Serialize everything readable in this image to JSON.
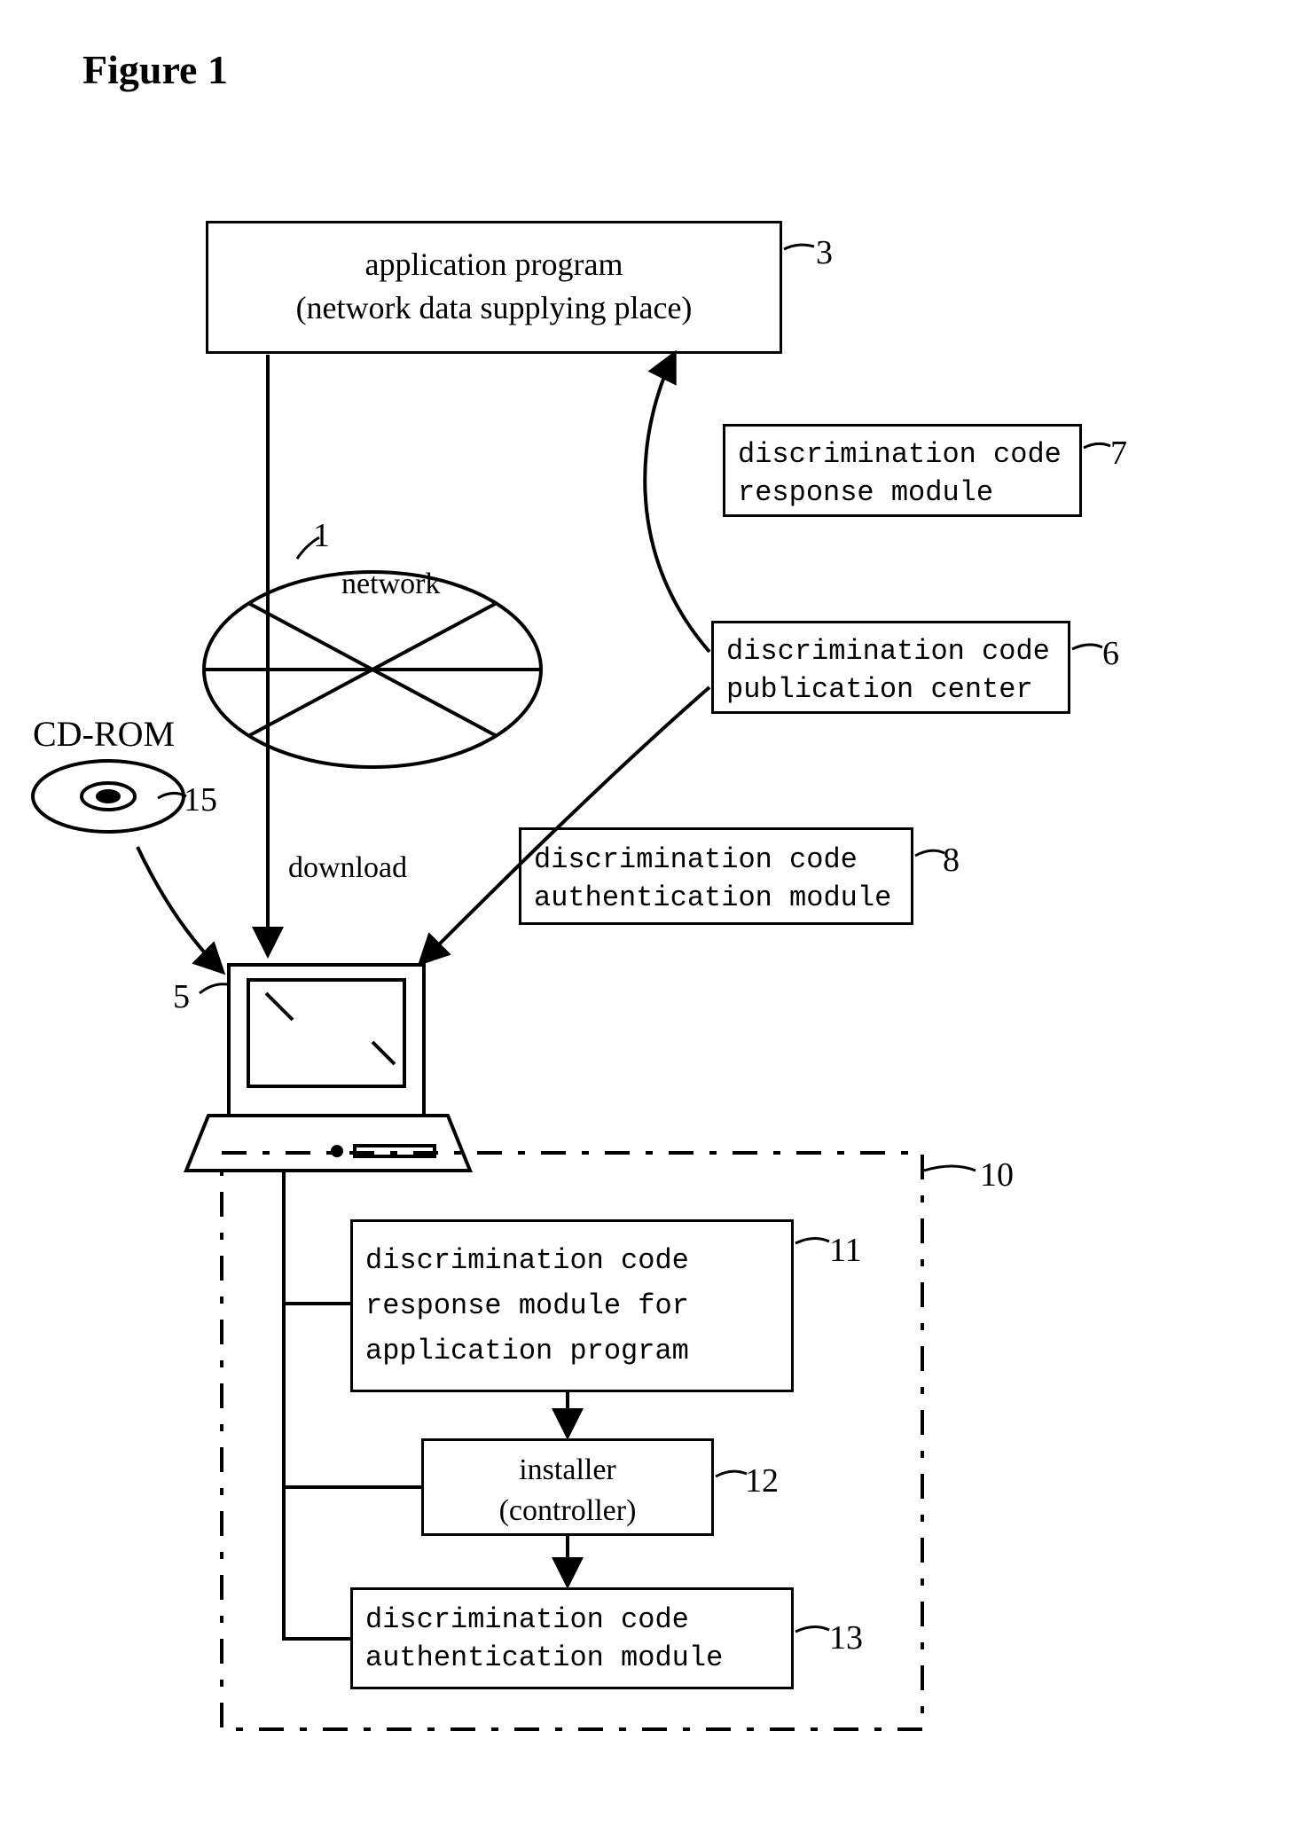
{
  "figure_title": "Figure 1",
  "nodes": {
    "app_program": {
      "line1": "application program",
      "line2": "(network data supplying place)",
      "ref": "3"
    },
    "disc_response": {
      "line1": "discrimination code",
      "line2": "response module",
      "ref": "7"
    },
    "network": {
      "label": "network",
      "ref": "1"
    },
    "pub_center": {
      "line1": "discrimination code",
      "line2": "publication center",
      "ref": "6"
    },
    "cdrom": {
      "label": "CD-ROM",
      "ref": "15"
    },
    "download_label": "download",
    "auth_module_top": {
      "line1": "discrimination code",
      "line2": "authentication module",
      "ref": "8"
    },
    "computer_ref": "5",
    "group_ref": "10",
    "disc_resp_app": {
      "line1": "discrimination code",
      "line2": "response module for",
      "line3": "application program",
      "ref": "11"
    },
    "installer": {
      "line1": "installer",
      "line2": "(controller)",
      "ref": "12"
    },
    "auth_module_bottom": {
      "line1": "discrimination code",
      "line2": "authentication module",
      "ref": "13"
    }
  }
}
